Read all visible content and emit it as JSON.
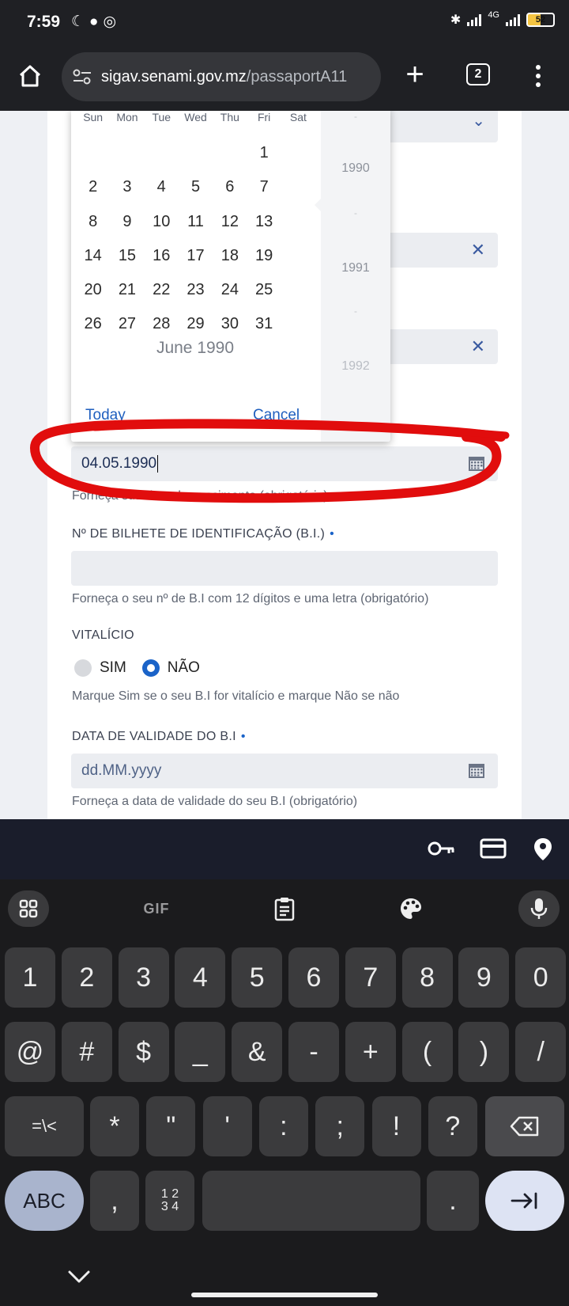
{
  "status_bar": {
    "time": "7:59",
    "left_icons": [
      "moon-icon",
      "chat-bubble-icon",
      "whatsapp-icon"
    ],
    "right_icons": [
      "bluetooth-icon",
      "signal-icon",
      "4g-signal-icon"
    ],
    "network_label": "4G",
    "battery": "52"
  },
  "browser": {
    "url_host": "sigav.senami.gov.mz",
    "url_path": "/passaportA11",
    "tab_count": "2"
  },
  "datepicker": {
    "weekdays": [
      "Sun",
      "Mon",
      "Tue",
      "Wed",
      "Thu",
      "Fri",
      "Sat"
    ],
    "leading_blanks": 5,
    "days": [
      "1",
      "2",
      "3",
      "4",
      "5",
      "6",
      "7",
      "8",
      "9",
      "10",
      "11",
      "12",
      "13",
      "14",
      "15",
      "16",
      "17",
      "18",
      "19",
      "20",
      "21",
      "22",
      "23",
      "24",
      "25",
      "26",
      "27",
      "28",
      "29",
      "30",
      "31"
    ],
    "month_title": "June 1990",
    "today_label": "Today",
    "cancel_label": "Cancel",
    "years": [
      "1990",
      "1991",
      "1992"
    ]
  },
  "form": {
    "birth_date_value": "04.05.1990",
    "birth_date_help": "Forneça sua data de nascimento (obrigatório)",
    "bi_label": "Nº DE BILHETE DE IDENTIFICAÇÃO (B.I.)",
    "bi_help": "Forneça o seu nº de B.I com 12 dígitos e uma letra (obrigatório)",
    "vitalicio_label": "VITALÍCIO",
    "radio_sim": "SIM",
    "radio_nao": "NÃO",
    "radio_selected": "NÃO",
    "vitalicio_help": "Marque Sim se o seu B.I for vitalício e marque Não se não",
    "validade_label": "DATA DE VALIDADE DO B.I",
    "validade_placeholder": "dd.MM.yyyy",
    "validade_help": "Forneça a data de validade do seu B.I (obrigatório)",
    "required_marker": "•",
    "ghost_close": "✕"
  },
  "keyboard": {
    "toolbar": {
      "gif_label": "GIF"
    },
    "row1": [
      "1",
      "2",
      "3",
      "4",
      "5",
      "6",
      "7",
      "8",
      "9",
      "0"
    ],
    "row2": [
      "@",
      "#",
      "$",
      "_",
      "&",
      "-",
      "+",
      "(",
      ")",
      "/"
    ],
    "row3": [
      "=\\<",
      "*",
      "\"",
      "'",
      ":",
      ";",
      "!",
      "?"
    ],
    "abc_label": "ABC",
    "comma": ",",
    "numpad_label": "1 2\n3 4",
    "period": "."
  },
  "colors": {
    "accent": "#1a63c8",
    "annotation": "#e10d0d"
  }
}
